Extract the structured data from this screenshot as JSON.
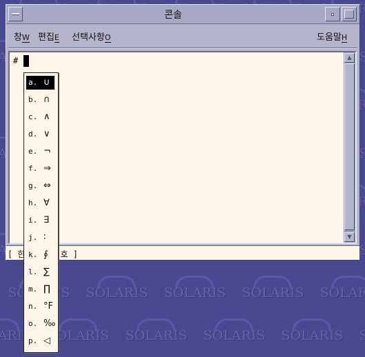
{
  "desktop": {
    "wallpaper_text": "SOLARIS"
  },
  "window": {
    "title": "콘솔",
    "menus": [
      {
        "label": "창",
        "mnemonic": "W"
      },
      {
        "label": "편집",
        "mnemonic": "E"
      },
      {
        "label": "선택사항",
        "mnemonic": "O"
      },
      {
        "label": "도움말",
        "mnemonic": "H"
      }
    ],
    "prompt": "#"
  },
  "status": {
    "text": "[ 한   수 기호 ]"
  },
  "popup": {
    "items": [
      {
        "label": "a.",
        "symbol": "∪"
      },
      {
        "label": "b.",
        "symbol": "∩"
      },
      {
        "label": "c.",
        "symbol": "∧"
      },
      {
        "label": "d.",
        "symbol": "∨"
      },
      {
        "label": "e.",
        "symbol": "¬"
      },
      {
        "label": "f.",
        "symbol": "⇒"
      },
      {
        "label": "g.",
        "symbol": "⇔"
      },
      {
        "label": "h.",
        "symbol": "∀"
      },
      {
        "label": "i.",
        "symbol": "∃"
      },
      {
        "label": "j.",
        "symbol": "∶"
      },
      {
        "label": "k.",
        "symbol": "∮"
      },
      {
        "label": "l.",
        "symbol": "∑"
      },
      {
        "label": "m.",
        "symbol": "∏"
      },
      {
        "label": "n.",
        "symbol": "°F"
      },
      {
        "label": "o.",
        "symbol": "‰"
      },
      {
        "label": "p.",
        "symbol": "◁"
      }
    ],
    "selected_index": 0
  }
}
